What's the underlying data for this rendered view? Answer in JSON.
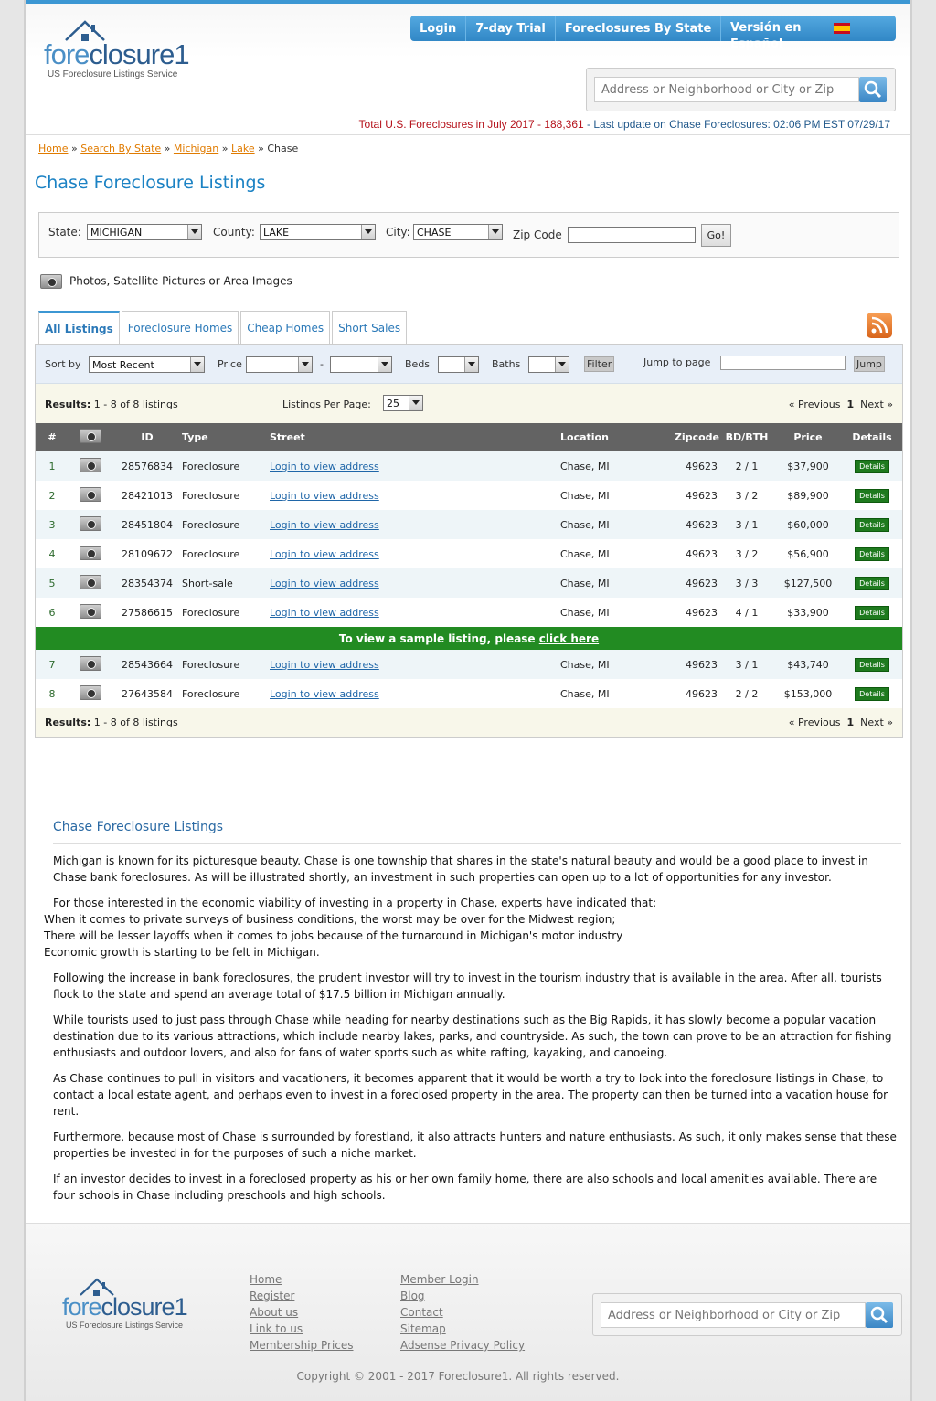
{
  "header": {
    "logo_word_a": "fore",
    "logo_word_b": "closure1",
    "logo_tagline": "US Foreclosure Listings Service",
    "nav": [
      "Login",
      "7-day Trial",
      "Foreclosures By State"
    ],
    "nav_lang": "Versión en Español",
    "search_placeholder": "Address or Neighborhood or City or Zip",
    "totals_red": "Total U.S. Foreclosures in July 2017 - 188,361",
    "totals_blue": " - Last update on Chase Foreclosures: 02:06 PM EST 07/29/17"
  },
  "breadcrumb": {
    "home": "Home",
    "sep": " » ",
    "search_by_state": "Search By State",
    "state": "Michigan",
    "county": "Lake",
    "current": "Chase"
  },
  "page_title": "Chase Foreclosure Listings",
  "filters": {
    "state_label": "State:",
    "state_value": "MICHIGAN",
    "county_label": "County:",
    "county_value": "LAKE",
    "city_label": "City:",
    "city_value": "CHASE",
    "zip_label": "Zip Code",
    "go_label": "Go!"
  },
  "photos_text": "Photos, Satellite Pictures or Area Images",
  "tabs": [
    "All Listings",
    "Foreclosure Homes",
    "Cheap Homes",
    "Short Sales"
  ],
  "sortbar": {
    "sort_label": "Sort by",
    "sort_value": "Most Recent",
    "price_label": "Price",
    "dash": "-",
    "beds_label": "Beds",
    "baths_label": "Baths",
    "filter_label": "Filter",
    "jump_label": "Jump to page",
    "jump_button": "Jump"
  },
  "results": {
    "label": "Results:",
    "text": " 1 - 8 of 8 listings",
    "per_page_label": "Listings Per Page:",
    "per_page_value": "25",
    "prev": "« Previous",
    "page": "1",
    "next": "Next »"
  },
  "table": {
    "headers": [
      "#",
      "",
      "ID",
      "Type",
      "Street",
      "Location",
      "Zipcode",
      "BD/BTH",
      "Price",
      "Details"
    ],
    "rows": [
      {
        "n": "1",
        "id": "28576834",
        "type": "Foreclosure",
        "street": "Login to view address",
        "loc": "Chase, MI",
        "zip": "49623",
        "bdbth": "2 / 1",
        "price": "$37,900",
        "details": "Details"
      },
      {
        "n": "2",
        "id": "28421013",
        "type": "Foreclosure",
        "street": "Login to view address",
        "loc": "Chase, MI",
        "zip": "49623",
        "bdbth": "3 / 2",
        "price": "$89,900",
        "details": "Details"
      },
      {
        "n": "3",
        "id": "28451804",
        "type": "Foreclosure",
        "street": "Login to view address",
        "loc": "Chase, MI",
        "zip": "49623",
        "bdbth": "3 / 1",
        "price": "$60,000",
        "details": "Details"
      },
      {
        "n": "4",
        "id": "28109672",
        "type": "Foreclosure",
        "street": "Login to view address",
        "loc": "Chase, MI",
        "zip": "49623",
        "bdbth": "3 / 2",
        "price": "$56,900",
        "details": "Details"
      },
      {
        "n": "5",
        "id": "28354374",
        "type": "Short-sale",
        "street": "Login to view address",
        "loc": "Chase, MI",
        "zip": "49623",
        "bdbth": "3 / 3",
        "price": "$127,500",
        "details": "Details"
      },
      {
        "n": "6",
        "id": "27586615",
        "type": "Foreclosure",
        "street": "Login to view address",
        "loc": "Chase, MI",
        "zip": "49623",
        "bdbth": "4 / 1",
        "price": "$33,900",
        "details": "Details"
      },
      {
        "n": "7",
        "id": "28543664",
        "type": "Foreclosure",
        "street": "Login to view address",
        "loc": "Chase, MI",
        "zip": "49623",
        "bdbth": "3 / 1",
        "price": "$43,740",
        "details": "Details"
      },
      {
        "n": "8",
        "id": "27643584",
        "type": "Foreclosure",
        "street": "Login to view address",
        "loc": "Chase, MI",
        "zip": "49623",
        "bdbth": "2 / 2",
        "price": "$153,000",
        "details": "Details"
      }
    ],
    "sample_text": "To view a sample listing, please ",
    "sample_link": "click here"
  },
  "article": {
    "title": "Chase Foreclosure Listings",
    "p1": "Michigan is known for its picturesque beauty. Chase is one township that shares in the state's natural beauty and would be a good place to invest in Chase bank foreclosures. As will be illustrated shortly, an investment in such properties can open up to a lot of opportunities for any investor.",
    "p2": "For those interested in the economic viability of investing in a property in Chase, experts have indicated that:",
    "li1": "When it comes to private surveys of business conditions, the worst may be over for the Midwest region;",
    "li2": "There will be lesser layoffs when it comes to jobs because of the turnaround in Michigan's motor industry",
    "li3": "Economic growth is starting to be felt in Michigan.",
    "p3": "Following the increase in bank foreclosures, the prudent investor will try to invest in the tourism industry that is available in the area. After all, tourists flock to the state and spend an average total of $17.5 billion in Michigan annually.",
    "p4": "While tourists used to just pass through Chase while heading for nearby destinations such as the Big Rapids, it has slowly become a popular vacation destination due to its various attractions, which include nearby lakes, parks, and countryside. As such, the town can prove to be an attraction for fishing enthusiasts and outdoor lovers, and also for fans of water sports such as white rafting, kayaking, and canoeing.",
    "p5": "As Chase continues to pull in visitors and vacationers, it becomes apparent that it would be worth a try to look into the foreclosure listings in Chase, to contact a local estate agent, and perhaps even to invest in a foreclosed property in the area. The property can then be turned into a vacation house for rent.",
    "p6": "Furthermore, because most of Chase is surrounded by forestland, it also attracts hunters and nature enthusiasts. As such, it only makes sense that these properties be invested in for the purposes of such a niche market.",
    "p7": "If an investor decides to invest in a foreclosed property as his or her own family home, there are also schools and local amenities available. There are four schools in Chase including preschools and high schools."
  },
  "footer": {
    "col1": [
      "Home",
      "Register",
      "About us",
      "Link to us",
      "Membership Prices"
    ],
    "col2": [
      "Member Login",
      "Blog",
      "Contact",
      "Sitemap",
      "Adsense Privacy Policy"
    ],
    "copyright": "Copyright © 2001 - 2017 Foreclosure1. All rights reserved."
  },
  "colors": {
    "accent": "#3c97d3",
    "green": "#228b22",
    "header_row": "#636363",
    "link_orange": "#e07b00"
  }
}
